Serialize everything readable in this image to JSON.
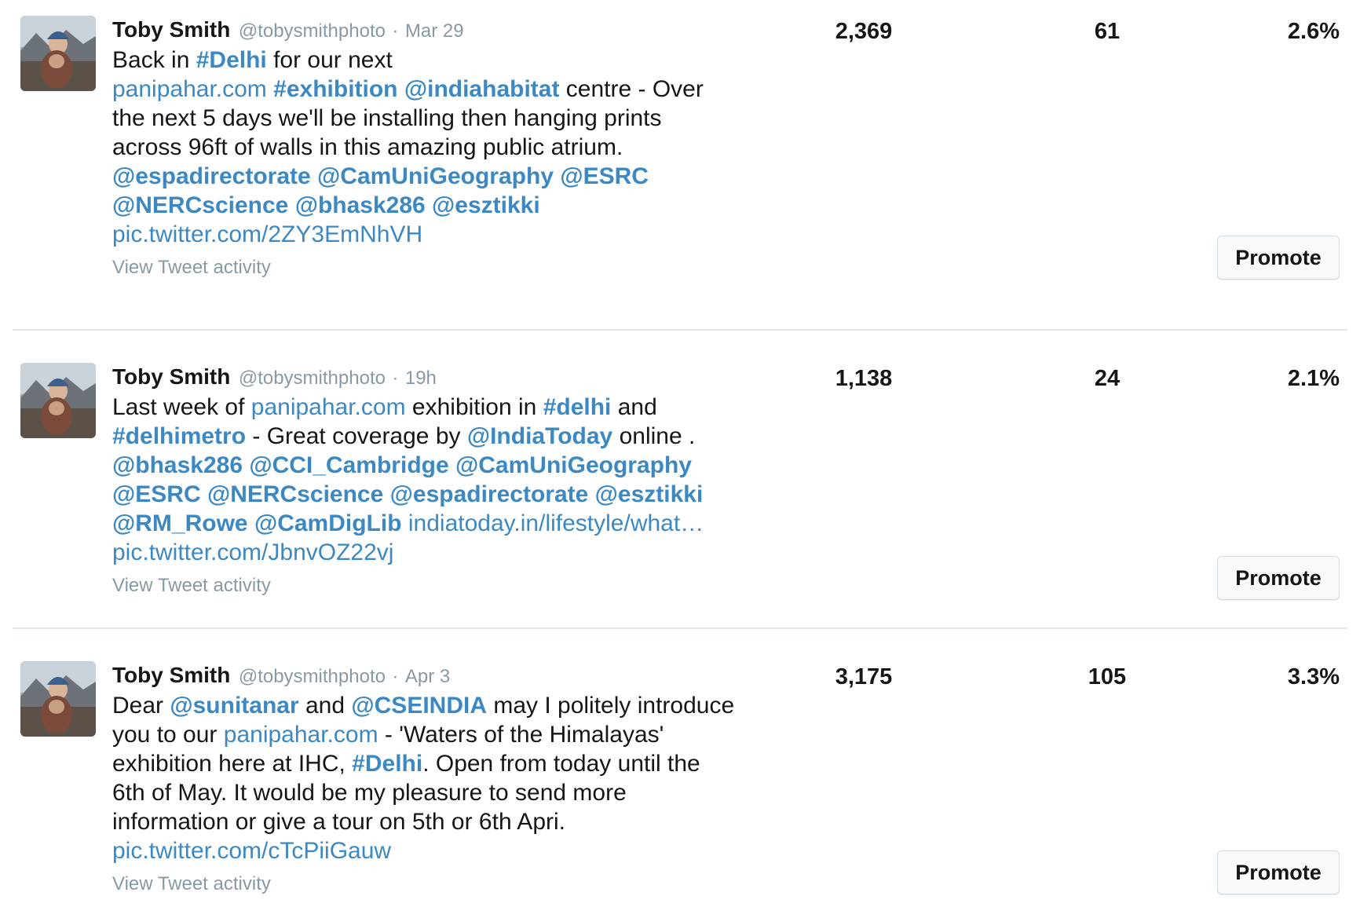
{
  "colors": {
    "link": "#3b88c3",
    "muted": "#8899a6",
    "text": "#14171a",
    "divider": "#e1e8ed"
  },
  "tweets": [
    {
      "author_name": "Toby Smith",
      "author_handle": "@tobysmithphoto",
      "separator": "·",
      "timestamp": "Mar 29",
      "lines": [
        [
          {
            "type": "text",
            "text": "Back in "
          },
          {
            "type": "hashtag",
            "text": "#Delhi"
          },
          {
            "type": "text",
            "text": " for our next"
          }
        ],
        [
          {
            "type": "link",
            "text": "panipahar.com"
          },
          {
            "type": "text",
            "text": " "
          },
          {
            "type": "hashtag",
            "text": "#exhibition"
          },
          {
            "type": "text",
            "text": " "
          },
          {
            "type": "mention",
            "text": "@indiahabitat"
          },
          {
            "type": "text",
            "text": " centre  - Over"
          }
        ],
        [
          {
            "type": "text",
            "text": "the next 5 days we'll be installing then hanging prints"
          }
        ],
        [
          {
            "type": "text",
            "text": "across 96ft of walls in this amazing public atrium."
          }
        ],
        [
          {
            "type": "mention",
            "text": "@espadirectorate"
          },
          {
            "type": "text",
            "text": " "
          },
          {
            "type": "mention",
            "text": "@CamUniGeography"
          },
          {
            "type": "text",
            "text": " "
          },
          {
            "type": "mention",
            "text": "@ESRC"
          }
        ],
        [
          {
            "type": "mention",
            "text": "@NERCscience"
          },
          {
            "type": "text",
            "text": " "
          },
          {
            "type": "mention",
            "text": "@bhask286"
          },
          {
            "type": "text",
            "text": " "
          },
          {
            "type": "mention",
            "text": "@esztikki"
          }
        ],
        [
          {
            "type": "link",
            "text": "pic.twitter.com/2ZY3EmNhVH"
          }
        ]
      ],
      "view_activity_label": "View Tweet activity",
      "impressions": "2,369",
      "engagements": "61",
      "engagement_rate": "2.6%",
      "promote_label": "Promote"
    },
    {
      "author_name": "Toby Smith",
      "author_handle": "@tobysmithphoto",
      "separator": "·",
      "timestamp": "19h",
      "lines": [
        [
          {
            "type": "text",
            "text": "Last week of "
          },
          {
            "type": "link",
            "text": "panipahar.com"
          },
          {
            "type": "text",
            "text": " exhibition in "
          },
          {
            "type": "hashtag",
            "text": "#delhi"
          },
          {
            "type": "text",
            "text": " and"
          }
        ],
        [
          {
            "type": "hashtag",
            "text": "#delhimetro"
          },
          {
            "type": "text",
            "text": " - Great coverage by "
          },
          {
            "type": "mention",
            "text": "@IndiaToday"
          },
          {
            "type": "text",
            "text": " online ."
          }
        ],
        [
          {
            "type": "mention",
            "text": "@bhask286"
          },
          {
            "type": "text",
            "text": " "
          },
          {
            "type": "mention",
            "text": "@CCI_Cambridge"
          },
          {
            "type": "text",
            "text": " "
          },
          {
            "type": "mention",
            "text": "@CamUniGeography"
          }
        ],
        [
          {
            "type": "mention",
            "text": "@ESRC"
          },
          {
            "type": "text",
            "text": " "
          },
          {
            "type": "mention",
            "text": "@NERCscience"
          },
          {
            "type": "text",
            "text": "  "
          },
          {
            "type": "mention",
            "text": "@espadirectorate"
          },
          {
            "type": "text",
            "text": " "
          },
          {
            "type": "mention",
            "text": "@esztikki"
          }
        ],
        [
          {
            "type": "mention",
            "text": "@RM_Rowe"
          },
          {
            "type": "text",
            "text": " "
          },
          {
            "type": "mention",
            "text": "@CamDigLib"
          },
          {
            "type": "text",
            "text": "  "
          },
          {
            "type": "link",
            "text": "indiatoday.in/lifestyle/what…"
          }
        ],
        [
          {
            "type": "link",
            "text": "pic.twitter.com/JbnvOZ22vj"
          }
        ]
      ],
      "view_activity_label": "View Tweet activity",
      "impressions": "1,138",
      "engagements": "24",
      "engagement_rate": "2.1%",
      "promote_label": "Promote"
    },
    {
      "author_name": "Toby Smith",
      "author_handle": "@tobysmithphoto",
      "separator": "·",
      "timestamp": "Apr 3",
      "lines": [
        [
          {
            "type": "text",
            "text": "Dear "
          },
          {
            "type": "mention",
            "text": "@sunitanar"
          },
          {
            "type": "text",
            "text": " and "
          },
          {
            "type": "mention",
            "text": "@CSEINDIA"
          },
          {
            "type": "text",
            "text": " may I politely introduce"
          }
        ],
        [
          {
            "type": "text",
            "text": "you  to our "
          },
          {
            "type": "link",
            "text": "panipahar.com"
          },
          {
            "type": "text",
            "text": " - 'Waters of the Himalayas'"
          }
        ],
        [
          {
            "type": "text",
            "text": "exhibition here at IHC, "
          },
          {
            "type": "hashtag",
            "text": "#Delhi"
          },
          {
            "type": "text",
            "text": ". Open from today until the"
          }
        ],
        [
          {
            "type": "text",
            "text": "6th of May. It would be my pleasure to send more"
          }
        ],
        [
          {
            "type": "text",
            "text": "information or give a tour on 5th or 6th Apri."
          }
        ],
        [
          {
            "type": "link",
            "text": "pic.twitter.com/cTcPiiGauw"
          }
        ]
      ],
      "view_activity_label": "View Tweet activity",
      "impressions": "3,175",
      "engagements": "105",
      "engagement_rate": "3.3%",
      "promote_label": "Promote"
    }
  ]
}
